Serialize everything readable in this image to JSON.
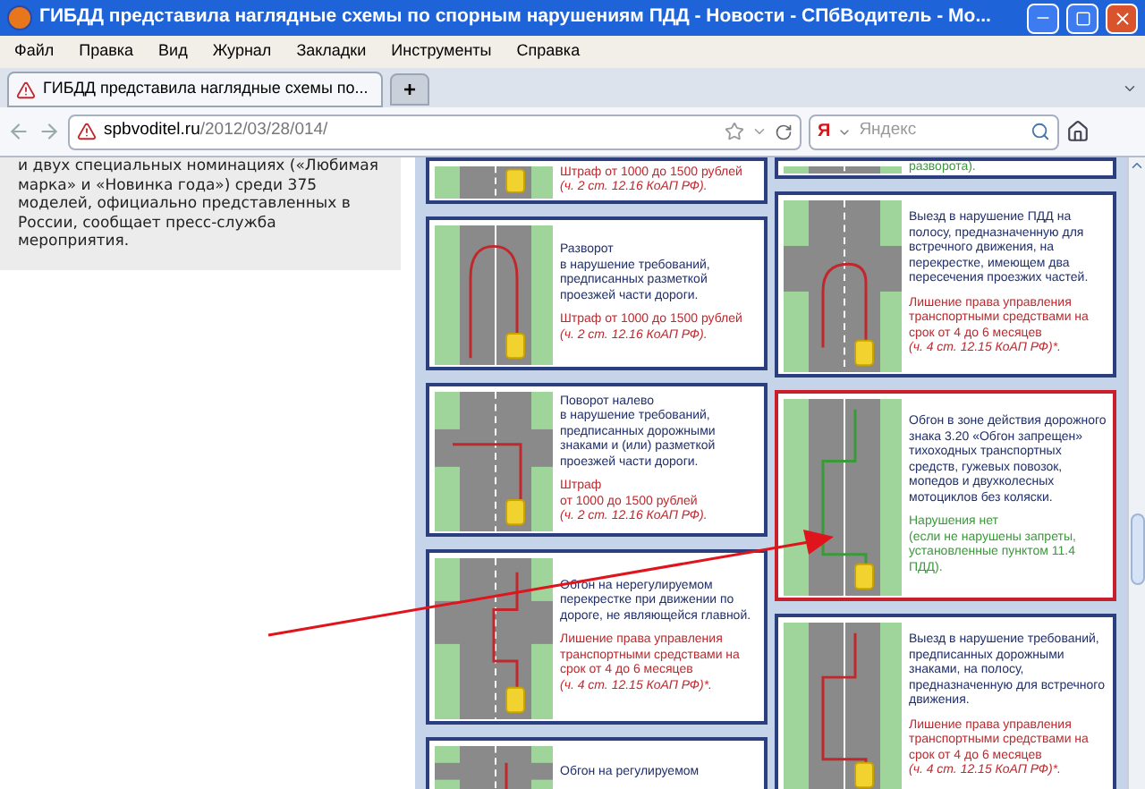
{
  "window": {
    "title": "ГИБДД представила наглядные схемы по спорным нарушениям ПДД - Новости - СПбВодитель - Mo..."
  },
  "menu": [
    "Файл",
    "Правка",
    "Вид",
    "Журнал",
    "Закладки",
    "Инструменты",
    "Справка"
  ],
  "tabs": [
    {
      "label": "ГИБДД представила наглядные схемы по...",
      "selected": true
    }
  ],
  "new_tab": "+",
  "address": {
    "domain": "spbvoditel.ru",
    "path": "/2012/03/28/014/"
  },
  "search": {
    "engine": "Я",
    "placeholder": "Яндекс"
  },
  "article_text": "и двух специальных номинациях («Любимая марка» и «Новинка года») среди 375 моделей, официально представленных в России, сообщает пресс-служба мероприятия.",
  "columns": [
    [
      {
        "kind": "straight",
        "verdict": {
          "kind": "fine",
          "text": "Штраф от 1000 до 1500 рублей",
          "reference": "(ч. 2 ст. 12.16 КоАП РФ)."
        },
        "highlighted": false
      },
      {
        "kind": "uturn",
        "description": "Разворот\nв нарушение требований, предписанных разметкой проезжей части дороги.",
        "verdict": {
          "kind": "fine",
          "text": "Штраф от 1000 до 1500 рублей",
          "reference": "(ч. 2 ст. 12.16 КоАП РФ)."
        },
        "highlighted": false
      },
      {
        "kind": "left-turn",
        "description": "Поворот налево\nв нарушение требований, предписанных дорожными знаками и (или) разметкой проезжей части дороги.",
        "verdict": {
          "kind": "fine",
          "text": "Штраф\nот 1000 до 1500 рублей",
          "reference": "(ч. 2 ст. 12.16 КоАП РФ)."
        },
        "highlighted": false
      },
      {
        "kind": "crossroad",
        "description": "Обгон на нерегулируемом перекрестке при движении по дороге, не являющейся главной.",
        "verdict": {
          "kind": "deprivation",
          "text": "Лишение права управления транспортными средствами на срок от 4 до 6 месяцев",
          "reference": "(ч. 4 ст. 12.15 КоАП РФ)*."
        },
        "highlighted": false
      },
      {
        "kind": "signal",
        "description": "Обгон на регулируемом",
        "highlighted": false
      }
    ],
    [
      {
        "kind": "straight",
        "verdict": {
          "kind": "ok",
          "text": "разворота)."
        },
        "highlighted": false
      },
      {
        "kind": "double-crossing",
        "description": "Выезд в нарушение ПДД на полосу, предназначенную для встречного движения, на перекрестке, имеющем два пересечения проезжих частей.",
        "verdict": {
          "kind": "deprivation",
          "text": "Лишение права управления транспортными средствами на срок от 4 до 6 месяцев",
          "reference": "(ч. 4 ст. 12.15 КоАП РФ)*."
        },
        "highlighted": false
      },
      {
        "kind": "overtake",
        "description": "Обгон в зоне действия дорожного знака 3.20 «Обгон запрещен» тихоходных транспортных средств, гужевых повозок, мопедов и двухколесных мотоциклов без коляски.",
        "verdict": {
          "kind": "ok",
          "text": "Нарушения нет\n(если не нарушены запреты, установленные пунктом 11.4 ПДД)."
        },
        "highlighted": true
      },
      {
        "kind": "overtake",
        "description": "Выезд в нарушение требований, предписанных дорожными знаками, на полосу, предназначенную для встречного движения.",
        "verdict": {
          "kind": "deprivation",
          "text": "Лишение права управления транспортными средствами на срок от 4 до 6 месяцев",
          "reference": "(ч. 4 ст. 12.15 КоАП РФ)*."
        },
        "highlighted": false
      }
    ]
  ]
}
